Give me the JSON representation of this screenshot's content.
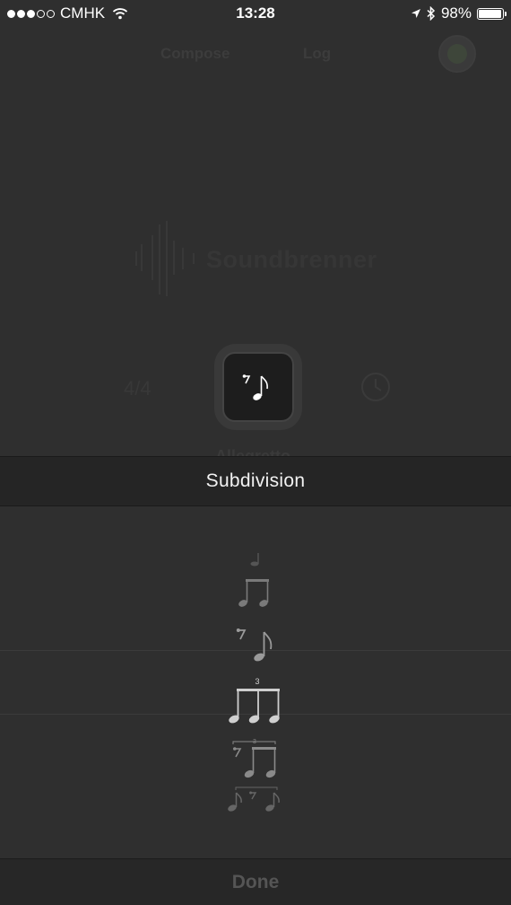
{
  "status_bar": {
    "carrier": "CMHK",
    "time": "13:28",
    "battery": "98%",
    "battery_level": 0.98,
    "signal_bars_filled": 3,
    "signal_bars_total": 5
  },
  "background": {
    "tabs": [
      "Compose",
      "Log"
    ],
    "logo_text": "Soundbrenner",
    "time_signature": "4/4",
    "tempo_name": "Allegretto"
  },
  "picker": {
    "title": "Subdivision",
    "done_label": "Done",
    "items": [
      {
        "name": "quarter",
        "symbol": "quarter-note-icon"
      },
      {
        "name": "two-eighths",
        "symbol": "beamed-eighths-icon"
      },
      {
        "name": "eighth-rest-eighth",
        "symbol": "rest-eighth-icon"
      },
      {
        "name": "triplet",
        "symbol": "triplet-eighths-icon",
        "tuplet": "3",
        "selected": true
      },
      {
        "name": "rest-two-triplet",
        "symbol": "rest-triplet-icon",
        "tuplet": "3"
      },
      {
        "name": "swing",
        "symbol": "swing-icon"
      }
    ]
  },
  "colors": {
    "background": "#2f2f2f",
    "header": "#252525",
    "text": "#f2f2f2",
    "done": "#555555"
  }
}
